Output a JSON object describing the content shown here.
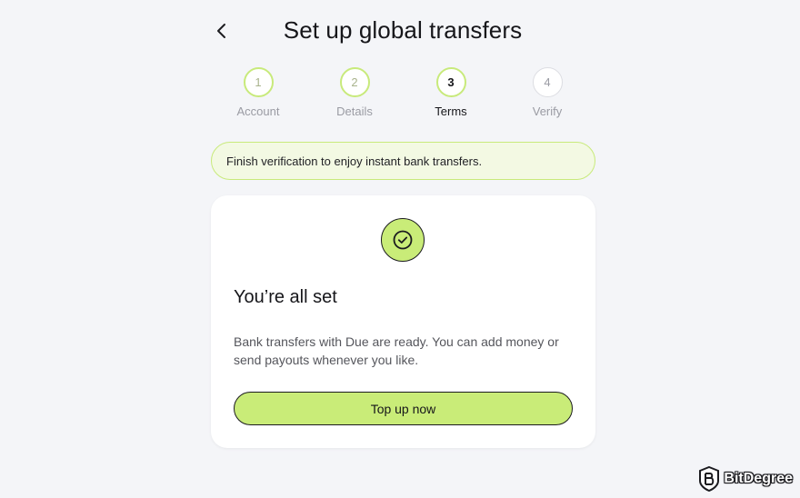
{
  "header": {
    "title": "Set up global transfers",
    "back_icon": "chevron-left-icon"
  },
  "steps": [
    {
      "number": "1",
      "label": "Account",
      "state": "done"
    },
    {
      "number": "2",
      "label": "Details",
      "state": "done"
    },
    {
      "number": "3",
      "label": "Terms",
      "state": "active"
    },
    {
      "number": "4",
      "label": "Verify",
      "state": "todo"
    }
  ],
  "banner": {
    "text": "Finish verification to enjoy instant bank transfers."
  },
  "card": {
    "icon": "check-circle-icon",
    "title": "You’re all set",
    "body": "Bank transfers with Due are ready. You can add money or send payouts whenever you like.",
    "cta_label": "Top up now"
  },
  "watermark": {
    "text": "BitDegree",
    "logo_icon": "bitdegree-logo-icon"
  },
  "colors": {
    "accent": "#c9ec78",
    "accent_border": "#c8ea7b",
    "banner_bg": "#f3f9e3",
    "page_bg": "#f4f5f8"
  }
}
